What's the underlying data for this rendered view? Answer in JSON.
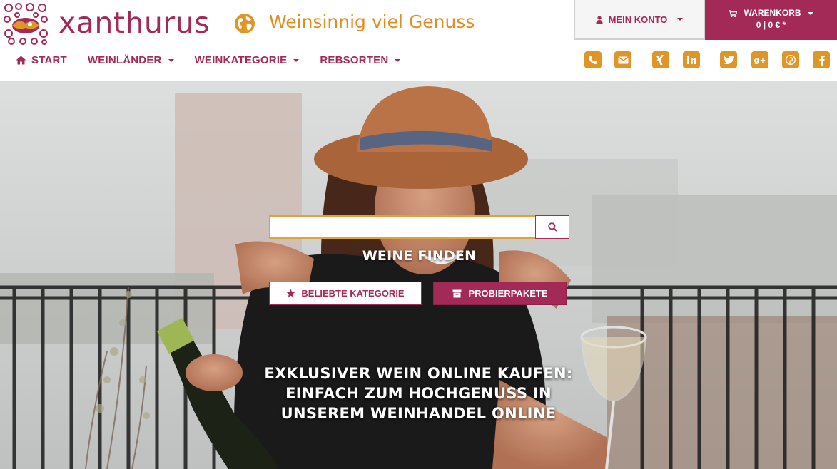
{
  "brand": {
    "name": "xanthurus",
    "tagline": "Weinsinnig viel Genuss"
  },
  "account": {
    "label": "MEIN KONTO"
  },
  "cart": {
    "label": "WARENKORB",
    "summary": "0 | 0 € *"
  },
  "nav": {
    "items": [
      {
        "label": "START",
        "icon": "home-icon"
      },
      {
        "label": "WEINLÄNDER",
        "dropdown": true
      },
      {
        "label": "WEINKATEGORIE",
        "dropdown": true
      },
      {
        "label": "REBSORTEN",
        "dropdown": true
      }
    ]
  },
  "social": {
    "items": [
      {
        "icon": "phone-icon"
      },
      {
        "icon": "envelope-icon"
      },
      {
        "icon": "xing-icon"
      },
      {
        "icon": "linkedin-icon"
      },
      {
        "icon": "twitter-icon"
      },
      {
        "icon": "google-plus-icon"
      },
      {
        "icon": "pinterest-icon"
      },
      {
        "icon": "facebook-icon"
      }
    ]
  },
  "hero": {
    "search": {
      "value": "",
      "placeholder": ""
    },
    "find_title": "WEINE FINDEN",
    "btn_category": "BELIEBTE KATEGORIE",
    "btn_probe": "PROBIERPAKETE",
    "headline_lines": [
      "EXKLUSIVER WEIN ONLINE KAUFEN:",
      "EINFACH ZUM HOCHGENUSS IN",
      "UNSEREM WEINHANDEL ONLINE"
    ]
  },
  "colors": {
    "brand": "#a32a57",
    "accent": "#e09627"
  }
}
